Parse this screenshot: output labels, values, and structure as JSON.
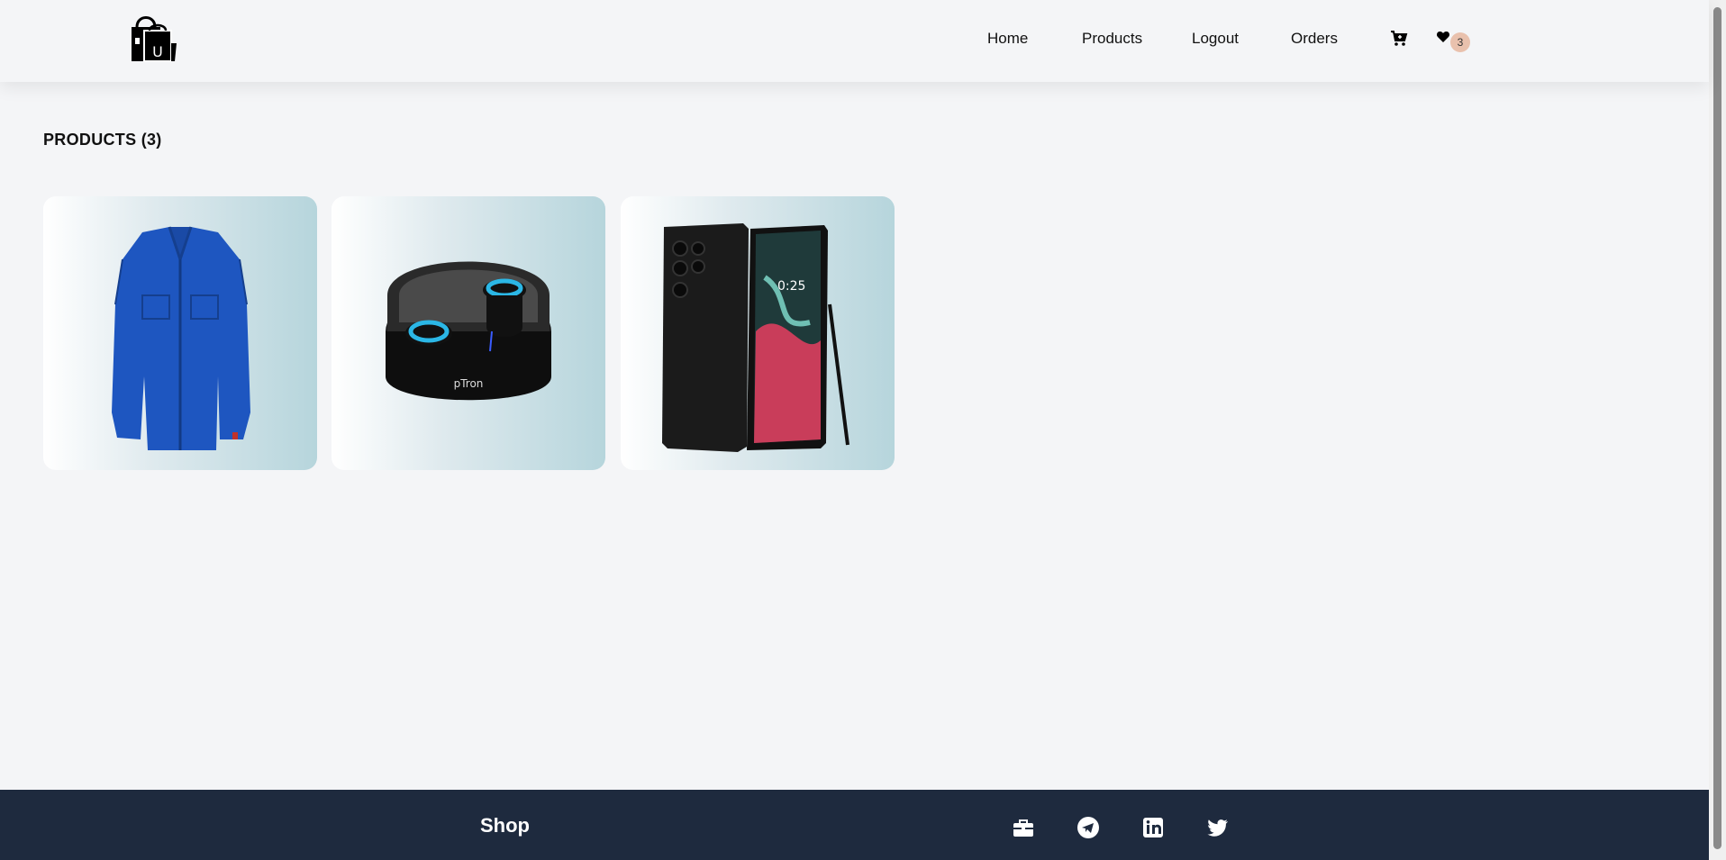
{
  "nav": {
    "links": [
      "Home",
      "Products",
      "Logout",
      "Orders"
    ],
    "wishlist_count": "3",
    "icons": [
      "shopping-bag-logo-icon",
      "cart-icon",
      "heart-icon"
    ],
    "logo_letter": "U"
  },
  "main": {
    "title": "PRODUCTS (3)",
    "products": [
      {
        "image": "blue-jacket"
      },
      {
        "image": "wireless-earbuds",
        "brand_mark": "pTron"
      },
      {
        "image": "black-smartphone",
        "screen_time": "0:25"
      }
    ]
  },
  "footer": {
    "brand": "Shop",
    "social_icons": [
      "briefcase-icon",
      "telegram-icon",
      "linkedin-icon",
      "twitter-icon"
    ]
  },
  "colors": {
    "background": "#f4f5f7",
    "footer": "#1e2a3e",
    "badge": "#e9c1ad",
    "jacket": "#1e56c0",
    "earbud_accent": "#2bb7e6"
  }
}
